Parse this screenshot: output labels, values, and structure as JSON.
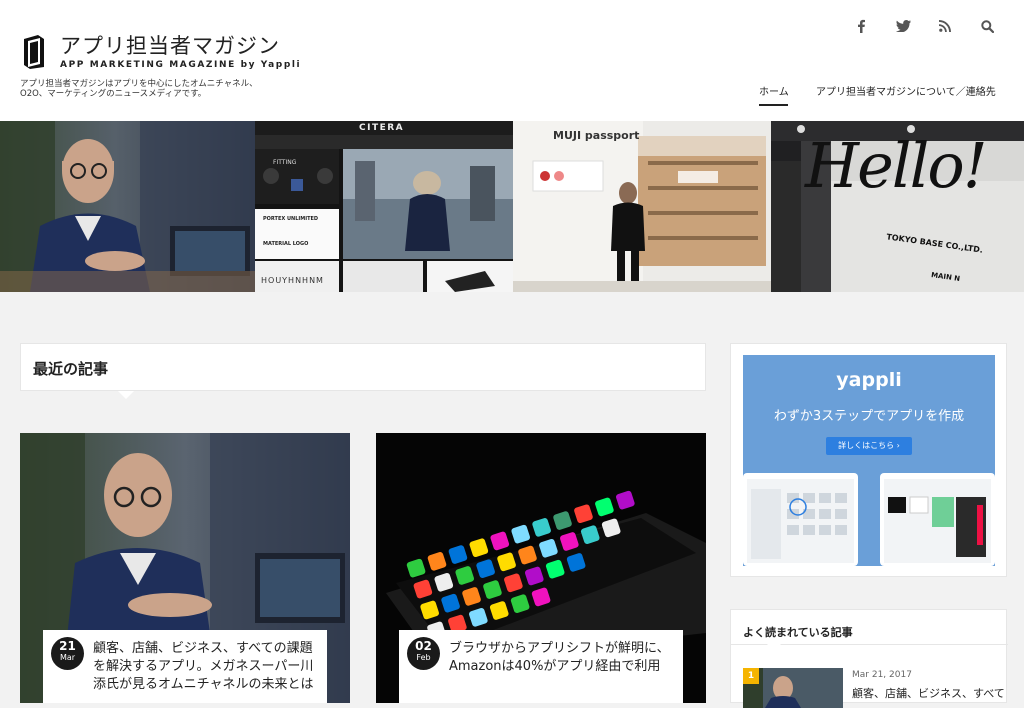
{
  "site": {
    "title": "アプリ担当者マガジン",
    "subtitle": "APP MARKETING MAGAZINE by Yappli",
    "description": "アプリ担当者マガジンはアプリを中心にしたオムニチャネル、O2O、マーケティングのニュースメディアです。"
  },
  "social": [
    {
      "icon": "facebook-icon",
      "glyph": "f"
    },
    {
      "icon": "twitter-icon",
      "glyph": "t"
    },
    {
      "icon": "rss-icon",
      "glyph": "rss"
    },
    {
      "icon": "search-icon",
      "glyph": "search"
    }
  ],
  "nav": {
    "home": "ホーム",
    "about": "アプリ担当者マガジンについて／連絡先"
  },
  "hero": {
    "tiles": [
      {
        "name": "hero-tile-interview"
      },
      {
        "name": "hero-tile-citera",
        "brand": "CITERA",
        "fitting": "FITTING",
        "portex": "PORTEX UNLIMITED",
        "material": "MATERIAL LOGO",
        "houy": "HOUYHNHNM"
      },
      {
        "name": "hero-tile-muji",
        "brand": "MUJI passport"
      },
      {
        "name": "hero-tile-hello",
        "hello": "Hello!",
        "sign": "TOKYO BASE CO.,LTD.",
        "sign2": "MAIN N"
      }
    ]
  },
  "recent": {
    "title": "最近の記事"
  },
  "articles": [
    {
      "day": "21",
      "month": "Mar",
      "text": "顧客、店舗、ビジネス、すべての課題を解決するアプリ。メガネスーパー川添氏が見るオムニチャネルの未来とは"
    },
    {
      "day": "02",
      "month": "Feb",
      "text": "ブラウザからアプリシフトが鮮明に、Amazonは40%がアプリ経由で利用"
    }
  ],
  "ad": {
    "logo": "yappli",
    "copy": "わずか3ステップでアプリを作成",
    "button": "詳しくはこちら ›"
  },
  "popular": {
    "title": "よく読まれている記事",
    "rank": "1",
    "date": "Mar 21, 2017",
    "text": "顧客、店舗、ビジネス、すべて"
  },
  "colors": {
    "accent": "#1a1a1a",
    "ad_bg": "#6a9fd8",
    "ad_button": "#2d7fe0",
    "rank_badge": "#f5b400"
  }
}
